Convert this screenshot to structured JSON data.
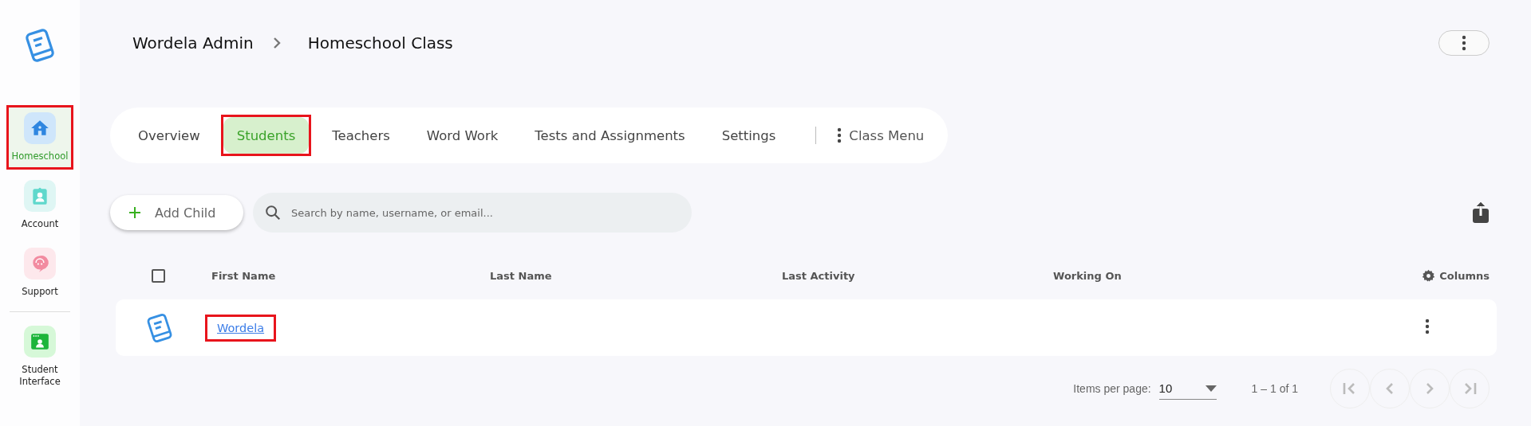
{
  "sidebar": {
    "items": [
      {
        "label": "Homeschool",
        "kind": "home",
        "selected": true,
        "highlighted": true
      },
      {
        "label": "Account",
        "kind": "account",
        "selected": false,
        "highlighted": false
      },
      {
        "label": "Support",
        "kind": "support",
        "selected": false,
        "highlighted": false
      },
      {
        "label": "Student Interface",
        "kind": "student",
        "selected": false,
        "highlighted": false
      }
    ]
  },
  "breadcrumb": [
    "Wordela Admin",
    "Homeschool Class"
  ],
  "tabs": [
    {
      "label": "Overview",
      "selected": false,
      "highlighted": false
    },
    {
      "label": "Students",
      "selected": true,
      "highlighted": true
    },
    {
      "label": "Teachers",
      "selected": false,
      "highlighted": false
    },
    {
      "label": "Word Work",
      "selected": false,
      "highlighted": false
    },
    {
      "label": "Tests and Assignments",
      "selected": false,
      "highlighted": false
    },
    {
      "label": "Settings",
      "selected": false,
      "highlighted": false
    }
  ],
  "class_menu": "Class Menu",
  "add_button": "Add Child",
  "search": {
    "placeholder": "Search by name, username, or email..."
  },
  "table": {
    "select_all": {
      "checked": false
    },
    "columns": [
      "First Name",
      "Last Name",
      "Last Activity",
      "Working On"
    ],
    "columns_button": "Columns",
    "rows": [
      {
        "first_name": "Wordela",
        "highlighted": true
      }
    ]
  },
  "paginator": {
    "label": "Items per page:",
    "page_size": "10",
    "range": "1 – 1 of 1"
  }
}
